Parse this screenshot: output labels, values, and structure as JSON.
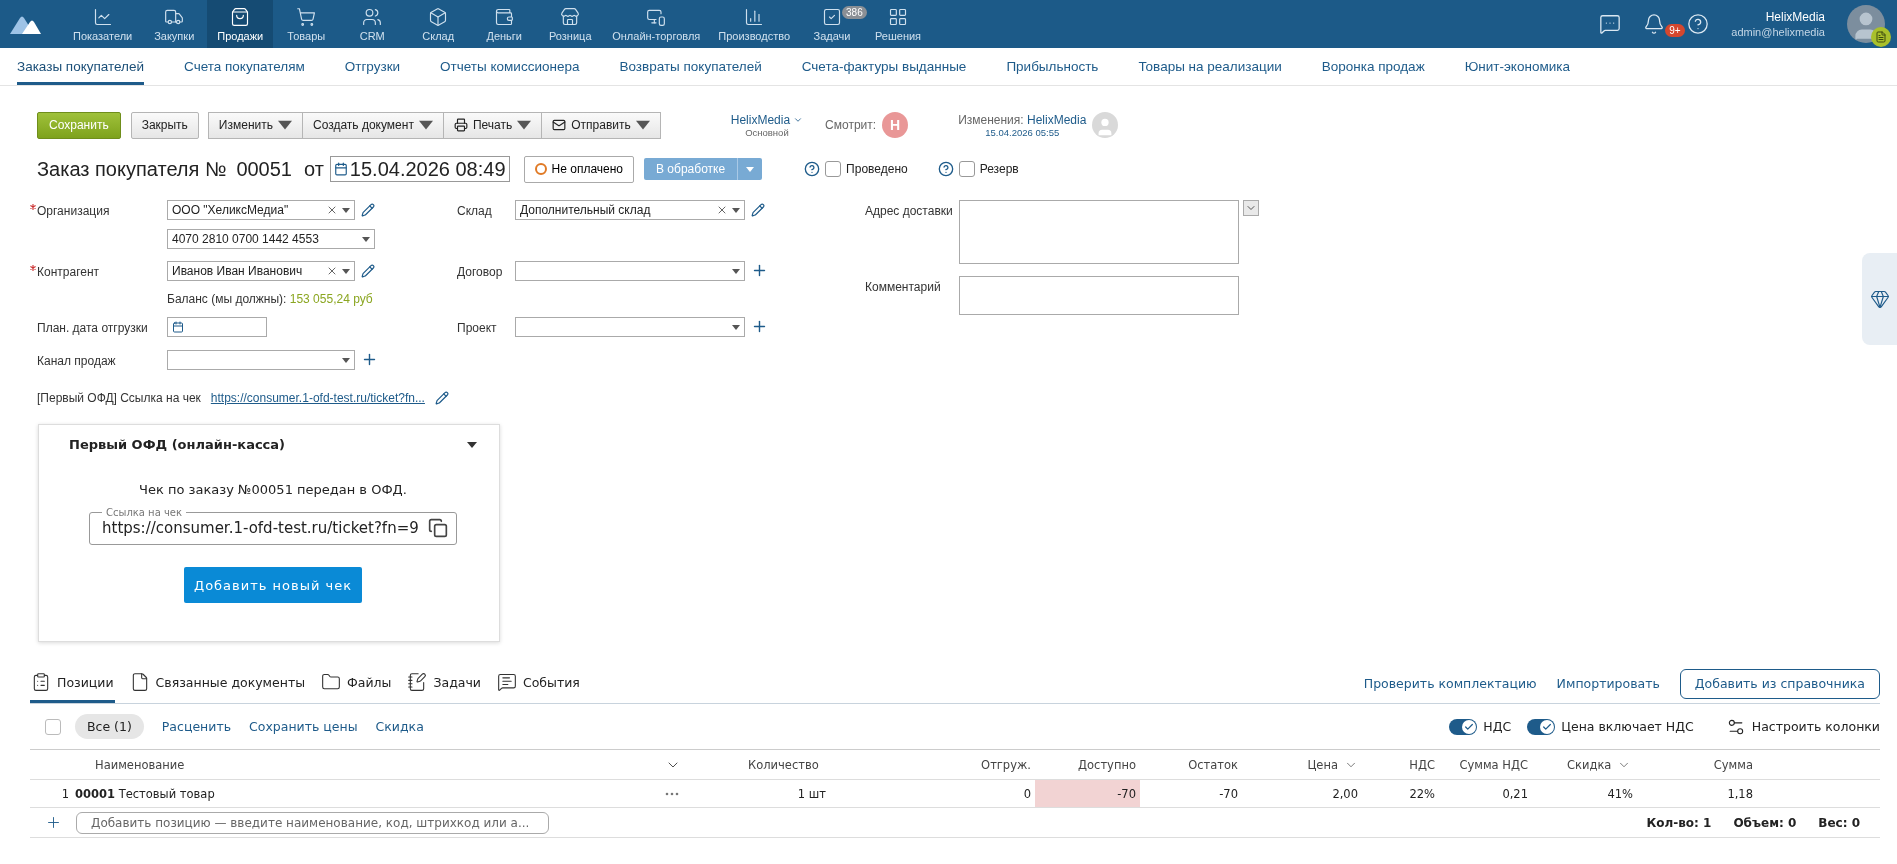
{
  "nav": {
    "items": [
      {
        "label": "Показатели",
        "selected": false
      },
      {
        "label": "Закупки",
        "selected": false
      },
      {
        "label": "Продажи",
        "selected": true
      },
      {
        "label": "Товары",
        "selected": false
      },
      {
        "label": "CRM",
        "selected": false
      },
      {
        "label": "Склад",
        "selected": false
      },
      {
        "label": "Деньги",
        "selected": false
      },
      {
        "label": "Розница",
        "selected": false
      },
      {
        "label": "Онлайн-торговля",
        "selected": false
      },
      {
        "label": "Производство",
        "selected": false
      },
      {
        "label": "Задачи",
        "selected": false,
        "badge": "386"
      },
      {
        "label": "Решения",
        "selected": false
      }
    ]
  },
  "header_right": {
    "notifications_badge": "9+",
    "user_name": "HelixMedia",
    "user_email": "admin@helixmedia"
  },
  "subnav": [
    {
      "label": "Заказы покупателей",
      "selected": true
    },
    {
      "label": "Счета покупателям",
      "selected": false
    },
    {
      "label": "Отгрузки",
      "selected": false
    },
    {
      "label": "Отчеты комиссионера",
      "selected": false
    },
    {
      "label": "Возвраты покупателей",
      "selected": false
    },
    {
      "label": "Счета-фактуры выданные",
      "selected": false
    },
    {
      "label": "Прибыльность",
      "selected": false
    },
    {
      "label": "Товары на реализации",
      "selected": false
    },
    {
      "label": "Воронка продаж",
      "selected": false
    },
    {
      "label": "Юнит-экономика",
      "selected": false
    }
  ],
  "toolbar": {
    "save": "Сохранить",
    "close": "Закрыть",
    "menus": [
      {
        "label": "Изменить",
        "kind": "plain"
      },
      {
        "label": "Создать документ",
        "kind": "plain"
      },
      {
        "label": "Печать",
        "kind": "print"
      },
      {
        "label": "Отправить",
        "kind": "mail"
      }
    ]
  },
  "account": {
    "name": "HelixMedia",
    "role": "Основной"
  },
  "viewing": {
    "label": "Смотрит:",
    "avatar_letter": "Н"
  },
  "changes": {
    "label": "Изменения:",
    "user": "HelixMedia",
    "date": "15.04.2026 05:55"
  },
  "title": {
    "text": "Заказ покупателя №",
    "number": "00051",
    "from": "от",
    "date": "15.04.2026 08:49"
  },
  "payment_status": "Не оплачено",
  "state": "В обработке",
  "checks": [
    {
      "label": "Проведено",
      "checked": false
    },
    {
      "label": "Резерв",
      "checked": false
    }
  ],
  "left_fields": [
    {
      "kind": "select",
      "label": "Организация",
      "required": true,
      "value": "ООО \"ХеликсМедиа\"",
      "clearable": true,
      "edit_button": true
    },
    {
      "kind": "select",
      "value": "4070 2810 0700 1442 4553"
    },
    {
      "kind": "select",
      "label": "Контрагент",
      "required": true,
      "value": "Иванов Иван Иванович",
      "clearable": true,
      "edit_button": true
    },
    {
      "kind": "note",
      "label": "Баланс (мы должны):",
      "value": "153 055,24 руб"
    },
    {
      "kind": "date",
      "label": "План. дата отгрузки"
    },
    {
      "kind": "select",
      "label": "Канал продаж",
      "add_button": true
    },
    {
      "kind": "link",
      "label": "[Первый ОФД] Ссылка на чек",
      "value": "https://consumer.1-ofd-test.ru/ticket?fn...",
      "edit_button": true
    }
  ],
  "middle_fields": [
    {
      "label": "Склад",
      "value": "Дополнительный склад",
      "clearable": true,
      "edit_button": true
    },
    {
      "label": "Договор",
      "add_button": true
    },
    {
      "label": "Проект",
      "add_button": true
    }
  ],
  "right_fields": [
    {
      "label": "Адрес доставки",
      "kind": "address"
    },
    {
      "label": "Комментарий",
      "kind": "comment"
    }
  ],
  "ofd_panel": {
    "title": "Первый ОФД (онлайн-касса)",
    "expanded": true,
    "message": "Чек по заказу №00051 передан в ОФД.",
    "field_label": "Ссылка на чек",
    "field_value": "https://consumer.1-ofd-test.ru/ticket?fn=9",
    "button": "Добавить новый чек"
  },
  "bottom_tabs": [
    {
      "label": "Позиции",
      "selected": true
    },
    {
      "label": "Связанные документы",
      "selected": false
    },
    {
      "label": "Файлы",
      "selected": false
    },
    {
      "label": "Задачи",
      "selected": false
    },
    {
      "label": "События",
      "selected": false
    }
  ],
  "bottom_actions": {
    "links": [
      "Проверить комплектацию",
      "Импортировать"
    ],
    "button": "Добавить из справочника"
  },
  "positions_toolbar": {
    "select_all_checked": false,
    "filter": "Все (1)",
    "links": [
      "Расценить",
      "Сохранить цены",
      "Скидка"
    ],
    "toggles": [
      {
        "label": "НДС",
        "on": true
      },
      {
        "label": "Цена включает НДС",
        "on": true
      }
    ],
    "columns_button": "Настроить колонки"
  },
  "table": {
    "columns": [
      {
        "label": "Наименование",
        "menu": true
      },
      {
        "label": "Количество",
        "menu": false
      },
      {
        "label": "Отгруж.",
        "menu": false
      },
      {
        "label": "Доступно",
        "menu": false
      },
      {
        "label": "Остаток",
        "menu": false
      },
      {
        "label": "Цена",
        "menu": true
      },
      {
        "label": "НДС",
        "menu": false
      },
      {
        "label": "Сумма НДС",
        "menu": false
      },
      {
        "label": "Скидка",
        "menu": true
      },
      {
        "label": "Сумма",
        "menu": false
      }
    ],
    "rows": [
      {
        "index": "1",
        "cells": [
          {
            "code": "00001",
            "text": "Тестовый товар",
            "alert": false
          },
          {
            "text": "1 шт",
            "alert": false
          },
          {
            "text": "0",
            "alert": false
          },
          {
            "text": "-70",
            "alert": true
          },
          {
            "text": "-70",
            "alert": false
          },
          {
            "text": "2,00",
            "alert": false
          },
          {
            "text": "22%",
            "alert": false
          },
          {
            "text": "0,21",
            "alert": false
          },
          {
            "text": "41%",
            "alert": false
          },
          {
            "text": "1,18",
            "alert": false
          }
        ]
      }
    ],
    "add_placeholder": "Добавить позицию — введите наименование, код, штрихкод или а...",
    "totals": [
      "Кол-во: 1",
      "Объем: 0",
      "Вес: 0"
    ]
  }
}
